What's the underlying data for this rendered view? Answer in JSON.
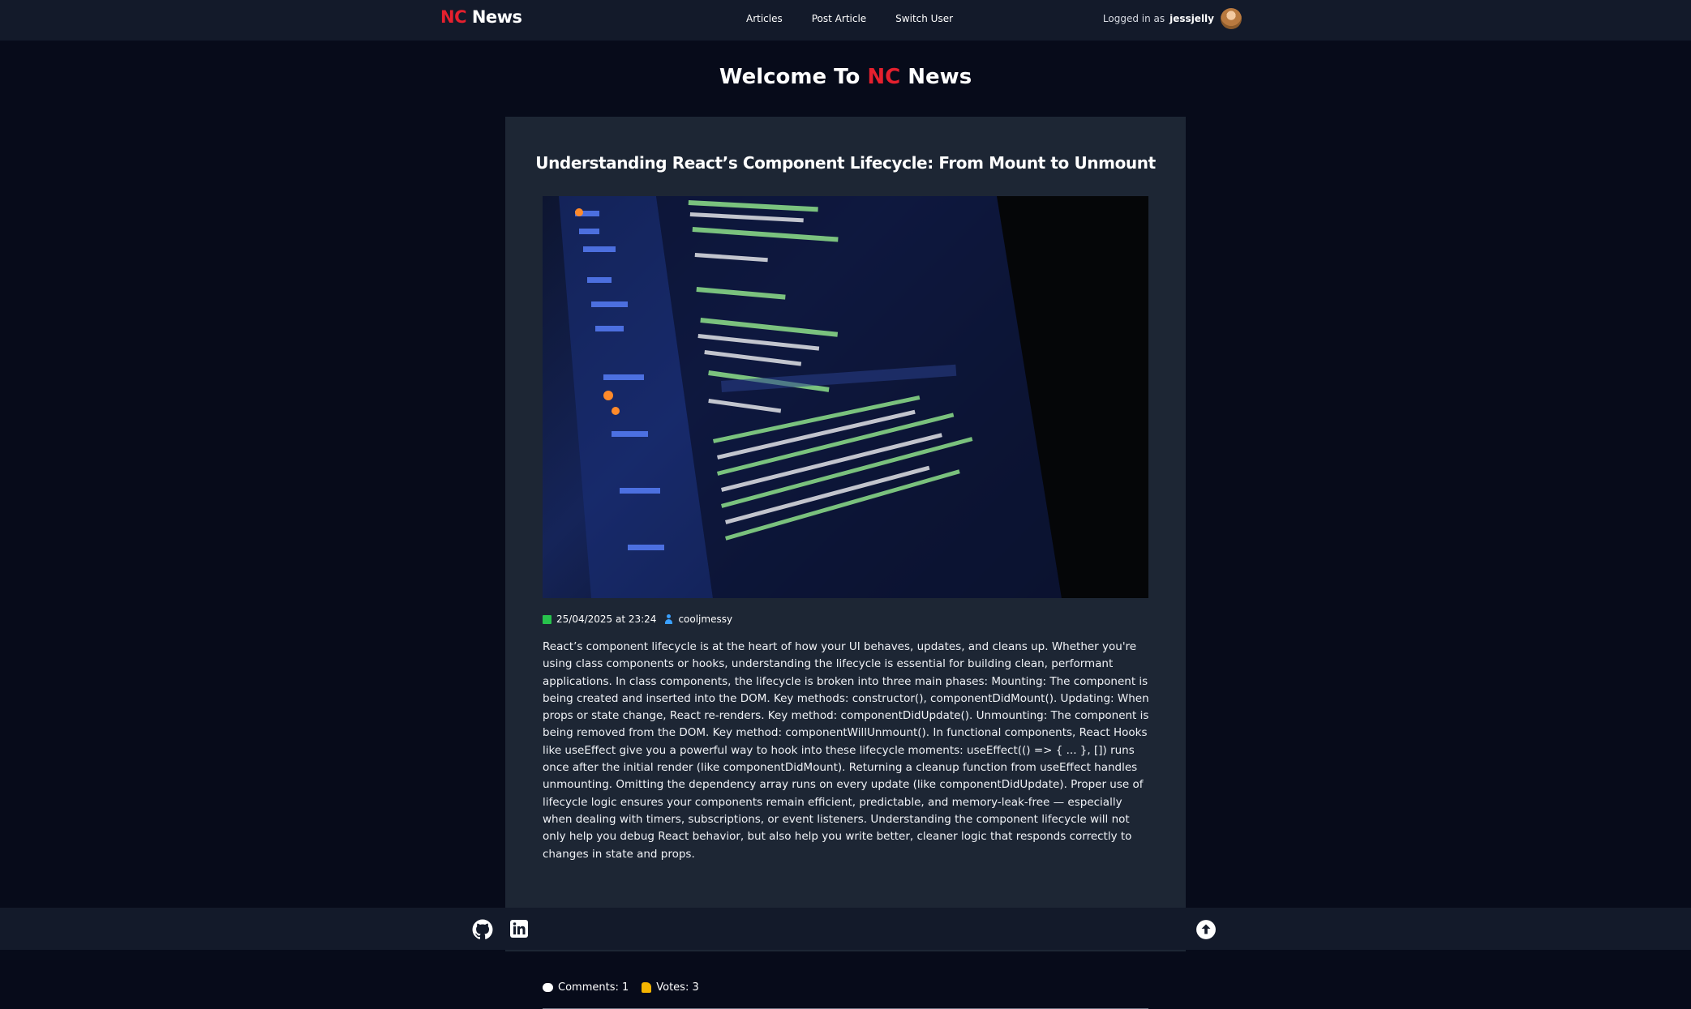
{
  "header": {
    "brand_nc": "NC",
    "brand_news": "News",
    "nav": [
      {
        "label": "Articles"
      },
      {
        "label": "Post Article"
      },
      {
        "label": "Switch User"
      }
    ],
    "logged_in_label": "Logged in as",
    "username": "jessjelly",
    "avatar_icon": "avatar"
  },
  "welcome": {
    "prefix": "Welcome To",
    "nc": "NC",
    "suffix": "News"
  },
  "article": {
    "title": "Understanding React’s Component Lifecycle: From Mount to Unmount",
    "image_icon": "code-screenshot-image",
    "date": "25/04/2025 at 23:24",
    "author": "cooljmessy",
    "body": "React’s component lifecycle is at the heart of how your UI behaves, updates, and cleans up. Whether you're using class components or hooks, understanding the lifecycle is essential for building clean, performant applications. In class components, the lifecycle is broken into three main phases: Mounting: The component is being created and inserted into the DOM. Key methods: constructor(), componentDidMount(). Updating: When props or state change, React re-renders. Key method: componentDidUpdate(). Unmounting: The component is being removed from the DOM. Key method: componentWillUnmount(). In functional components, React Hooks like useEffect give you a powerful way to hook into these lifecycle moments: useEffect(() => { ... }, []) runs once after the initial render (like componentDidMount). Returning a cleanup function from useEffect handles unmounting. Omitting the dependency array runs on every update (like componentDidUpdate). Proper use of lifecycle logic ensures your components remain efficient, predictable, and memory-leak-free — especially when dealing with timers, subscriptions, or event listeners. Understanding the component lifecycle will not only help you debug React behavior, but also help you write better, cleaner logic that responds correctly to changes in state and props.",
    "comments_label": "Comments: 1",
    "votes_label": "Votes: 3"
  },
  "footer": {
    "icons": [
      "github-icon",
      "linkedin-icon",
      "scroll-to-top-icon"
    ]
  },
  "colors": {
    "accent": "#e5202e",
    "navbar": "#131a2a",
    "background": "#070b1a",
    "card": "#1d2634"
  }
}
